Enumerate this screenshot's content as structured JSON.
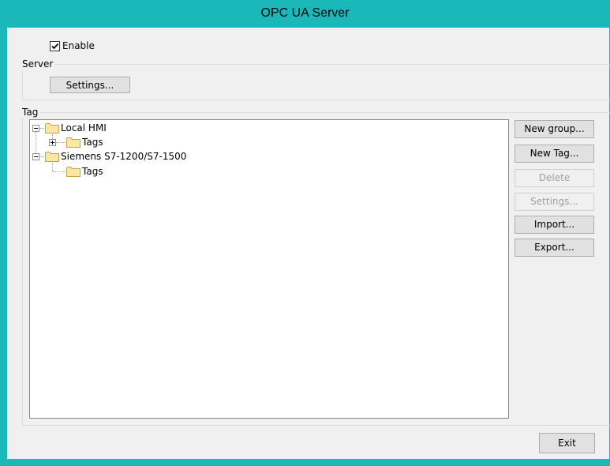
{
  "window": {
    "title": "OPC UA Server"
  },
  "enable": {
    "label": "Enable",
    "checked": true
  },
  "server": {
    "group_label": "Server",
    "settings_label": "Settings..."
  },
  "tag": {
    "group_label": "Tag",
    "tree": [
      {
        "label": "Local HMI",
        "expanded": true,
        "children": [
          {
            "label": "Tags",
            "expanded": false
          }
        ]
      },
      {
        "label": "Siemens S7-1200/S7-1500",
        "expanded": true,
        "children": [
          {
            "label": "Tags"
          }
        ]
      }
    ],
    "buttons": {
      "new_group": "New group...",
      "new_tag": "New Tag...",
      "delete": "Delete",
      "settings": "Settings...",
      "import": "Import...",
      "export": "Export..."
    }
  },
  "footer": {
    "exit_label": "Exit"
  },
  "icons": {
    "folder": "folder-icon",
    "expander": "expander-icon",
    "check": "check-icon"
  },
  "colors": {
    "title_bar": "#1bb8b9",
    "folder_fill": "#fbe7a3",
    "folder_stroke": "#c8a34a"
  }
}
